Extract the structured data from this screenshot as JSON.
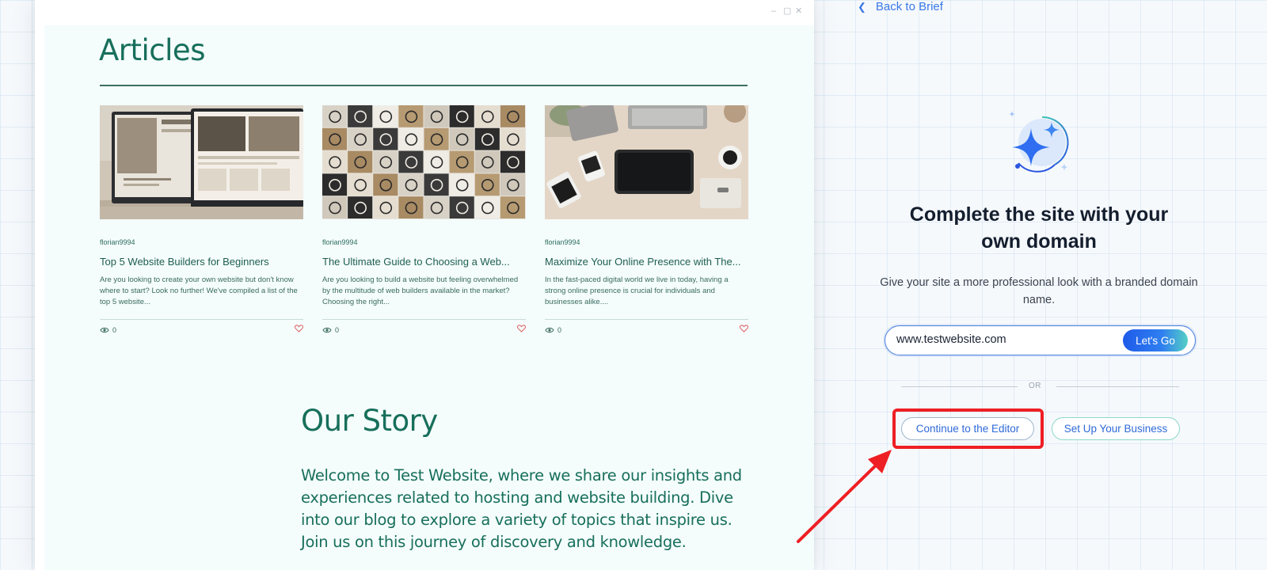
{
  "window_controls": {
    "minimize": "–",
    "maximize": "▢",
    "close": "✕"
  },
  "back_link": {
    "label": "Back to Brief"
  },
  "site": {
    "articles_title": "Articles",
    "articles": [
      {
        "author": "florian9994",
        "title": "Top 5 Website Builders for Beginners",
        "excerpt": "Are you looking to create your own website but don't know where to start? Look no further! We've compiled a list of the top 5 website...",
        "views": "0"
      },
      {
        "author": "florian9994",
        "title": "The Ultimate Guide to Choosing a Web...",
        "excerpt": "Are you looking to build a website but feeling overwhelmed by the multitude of web builders available in the market? Choosing the right...",
        "views": "0"
      },
      {
        "author": "florian9994",
        "title": "Maximize Your Online Presence with The...",
        "excerpt": "In the fast-paced digital world we live in today, having a strong online presence is crucial for individuals and businesses alike....",
        "views": "0"
      }
    ],
    "story_title": "Our Story",
    "story_body": "Welcome to Test Website, where we share our insights and experiences related to hosting and website building. Dive into our blog to explore a variety of topics that inspire us. Join us on this journey of discovery and knowledge."
  },
  "promo": {
    "title_line1": "Complete the site with your",
    "title_line2": "own domain",
    "description": "Give your site a more professional look with a branded domain name.",
    "domain_value": "www.testwebsite.com",
    "go_label": "Let's Go",
    "or_label": "OR",
    "continue_label": "Continue to the Editor",
    "business_label": "Set Up Your Business"
  },
  "colors": {
    "brand_green": "#176f5b",
    "accent_blue": "#2f6ad8",
    "annotation_red": "#ee1f24"
  }
}
